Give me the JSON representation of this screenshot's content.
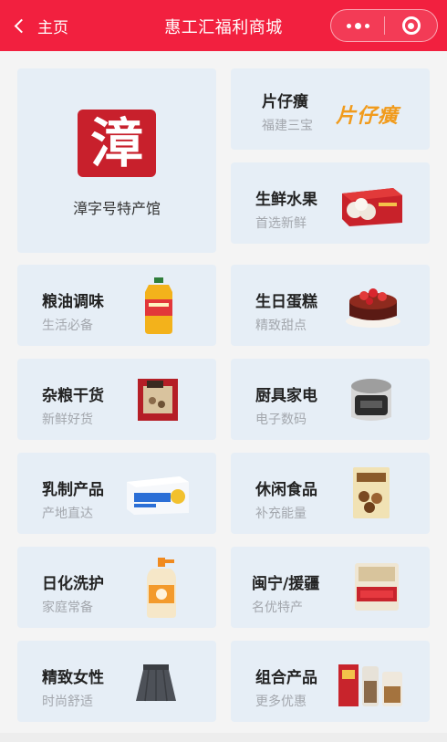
{
  "header": {
    "back_label": "主页",
    "title": "惠工汇福利商城",
    "bg_color": "#f2203f"
  },
  "featured": {
    "seal_char": "漳",
    "label": "漳字号特产馆"
  },
  "cards": [
    {
      "name": "片仔癀",
      "sub": "福建三宝",
      "brand": "片仔癀",
      "icon": "pianzaihuang-logo-icon"
    },
    {
      "name": "生鲜水果",
      "sub": "首选新鲜",
      "icon": "fruit-box-icon"
    },
    {
      "name": "粮油调味",
      "sub": "生活必备",
      "icon": "oil-bottle-icon"
    },
    {
      "name": "生日蛋糕",
      "sub": "精致甜点",
      "icon": "cake-icon"
    },
    {
      "name": "杂粮干货",
      "sub": "新鲜好货",
      "icon": "grain-bag-icon"
    },
    {
      "name": "厨具家电",
      "sub": "电子数码",
      "icon": "rice-cooker-icon"
    },
    {
      "name": "乳制产品",
      "sub": "产地直达",
      "icon": "milk-box-icon"
    },
    {
      "name": "休闲食品",
      "sub": "补充能量",
      "icon": "snack-bag-icon"
    },
    {
      "name": "日化洗护",
      "sub": "家庭常备",
      "icon": "detergent-bottle-icon"
    },
    {
      "name": "闽宁/援疆",
      "sub": "名优特产",
      "icon": "rice-sack-icon"
    },
    {
      "name": "精致女性",
      "sub": "时尚舒适",
      "icon": "skirt-icon"
    },
    {
      "name": "组合产品",
      "sub": "更多优惠",
      "icon": "gift-set-icon"
    }
  ]
}
